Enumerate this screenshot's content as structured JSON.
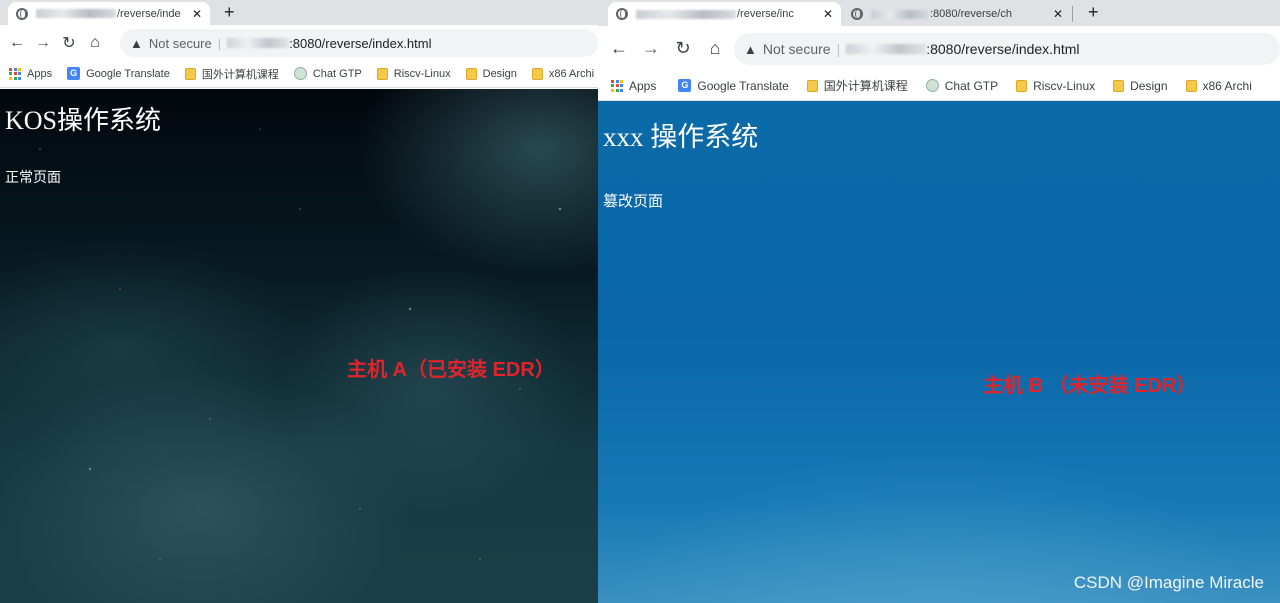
{
  "left_window": {
    "tab": {
      "title": "/reverse/inde"
    },
    "address_bar": {
      "security_label": "Not secure",
      "url": ":8080/reverse/index.html"
    },
    "bookmarks": [
      "Apps",
      "Google Translate",
      "国外计算机课程",
      "Chat GTP",
      "Riscv-Linux",
      "Design",
      "x86 Archi"
    ],
    "page": {
      "title": "KOS操作系统",
      "text": "正常页面"
    },
    "annotation": "主机 A（已安装 EDR）"
  },
  "right_window": {
    "tabs": [
      {
        "title": "/reverse/inc"
      },
      {
        "title": ":8080/reverse/ch"
      }
    ],
    "address_bar": {
      "security_label": "Not secure",
      "url": ":8080/reverse/index.html"
    },
    "bookmarks": [
      "Apps",
      "Google Translate",
      "国外计算机课程",
      "Chat GTP",
      "Riscv-Linux",
      "Design",
      "x86 Archi"
    ],
    "page": {
      "title": "xxx 操作系统",
      "text": "篡改页面"
    },
    "annotation": "主机 B （未安装 EDR）"
  },
  "watermark": "CSDN @Imagine Miracle",
  "colors": {
    "annotation": "#e0242c",
    "left_background": "#0a1e26",
    "right_background": "#0a66a8"
  }
}
